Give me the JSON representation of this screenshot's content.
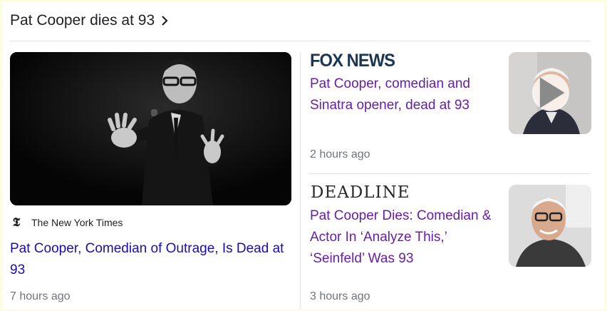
{
  "header": {
    "title": "Pat Cooper dies at 93",
    "chevron_icon": "chevron-right-icon"
  },
  "stories": [
    {
      "source": "The New York Times",
      "source_icon": "nyt-logo-icon",
      "title": "Pat Cooper, Comedian of Outrage, Is Dead at 93",
      "time": "7 hours ago"
    },
    {
      "source": "FOX NEWS",
      "title": "Pat Cooper, comedian and Sinatra opener, dead at 93",
      "time": "2 hours ago",
      "has_video": true,
      "video_icon": "play-icon"
    },
    {
      "source": "DEADLINE",
      "title": "Pat Cooper Dies: Comedian & Actor In ‘Analyze This,’ ‘Seinfeld’ Was 93",
      "time": "3 hours ago"
    }
  ],
  "colors": {
    "link": "#1a0dab",
    "visited_link": "#681da8",
    "meta": "#70757a",
    "outer_background": "#fdfde3"
  }
}
